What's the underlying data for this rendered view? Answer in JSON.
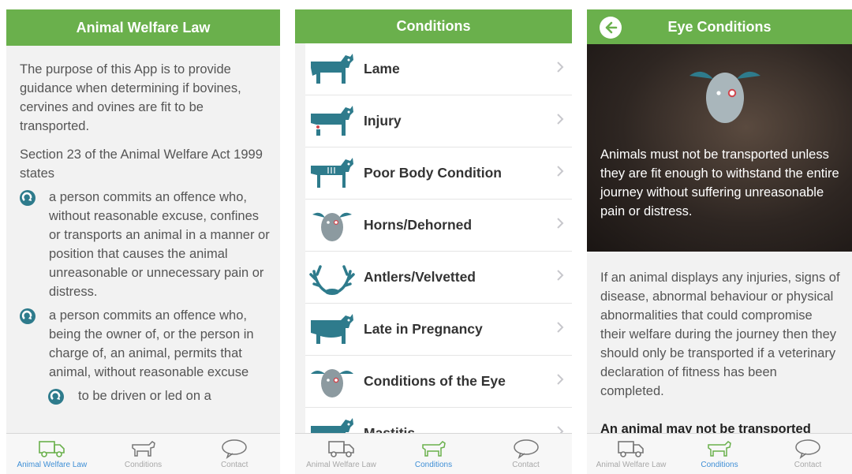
{
  "screens": {
    "law": {
      "title": "Animal Welfare Law",
      "intro": "The purpose of this App is to provide guidance when determining if bovines, cervines and ovines are fit to be transported.",
      "section": "Section 23 of the Animal Welfare Act 1999 states",
      "bullets": [
        "a person commits an offence who, without reasonable excuse, confines or transports an animal in a manner or position that causes the animal unreasonable or unnecessary pain or distress.",
        "a person commits an offence who, being the owner of, or the person in charge of, an animal, permits that animal, without reasonable excuse"
      ],
      "sub_bullet": "to be driven or led on a"
    },
    "conditions": {
      "title": "Conditions",
      "items": [
        {
          "label": "Lame",
          "icon": "cow-lame-icon"
        },
        {
          "label": "Injury",
          "icon": "cow-injury-icon"
        },
        {
          "label": "Poor Body Condition",
          "icon": "cow-thin-icon"
        },
        {
          "label": "Horns/Dehorned",
          "icon": "horns-head-icon"
        },
        {
          "label": "Antlers/Velvetted",
          "icon": "antlers-icon"
        },
        {
          "label": "Late in Pregnancy",
          "icon": "cow-pregnant-icon"
        },
        {
          "label": "Conditions of the Eye",
          "icon": "eye-head-icon"
        },
        {
          "label": "Mastitis",
          "icon": "cow-mastitis-icon"
        }
      ]
    },
    "eye": {
      "title": "Eye Conditions",
      "hero_text": "Animals must not be transported unless they are fit enough to withstand the entire journey without suffering unreasonable pain or distress.",
      "body": "If an animal displays any injuries, signs of disease, abnormal behaviour or physical abnormalities that could compromise their welfare during the journey then they should only be transported if a veterinary declaration of fitness has been completed.",
      "bold": "An animal may not be transported"
    }
  },
  "tabs": {
    "law": "Animal Welfare Law",
    "conditions": "Conditions",
    "contact": "Contact"
  },
  "colors": {
    "header_green": "#6ab04c",
    "icon_teal": "#2e7b8c",
    "active_tab": "#3f8fd6"
  }
}
